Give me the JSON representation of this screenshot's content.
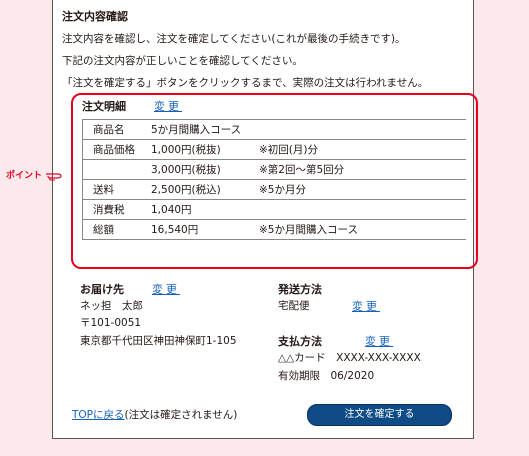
{
  "intro": {
    "title": "注文内容確認",
    "line1": "注文内容を確認し、注文を確定してください(これが最後の手続きです)。",
    "line2": "下記の注文内容が正しいことを確認してください。",
    "line3": "「注文を確定する」ボタンをクリックするまで、実際の注文は行われません。"
  },
  "point_label": "ポイント",
  "details": {
    "title": "注文明細",
    "change_link": "変更",
    "rows": [
      {
        "label": "商品名",
        "value": "5か月間購入コース",
        "note": ""
      },
      {
        "label": "商品価格",
        "value": "1,000円(税抜)",
        "note": "※初回(月)分"
      },
      {
        "label": "",
        "value": "3,000円(税抜)",
        "note": "※第2回〜第5回分"
      },
      {
        "label": "送料",
        "value": "2,500円(税込)",
        "note": "※5か月分"
      },
      {
        "label": "消費税",
        "value": "1,040円",
        "note": ""
      },
      {
        "label": "総額",
        "value": "16,540円",
        "note": "※5か月間購入コース"
      }
    ]
  },
  "delivery": {
    "title": "お届け先",
    "change_link": "変更",
    "name": "ネッ担　太郎",
    "postal": "〒101-0051",
    "address": "東京都千代田区神田神保町1-105"
  },
  "shipping": {
    "title": "発送方法",
    "method": "宅配便",
    "change_link": "変更"
  },
  "payment": {
    "title": "支払方法",
    "change_link": "変更",
    "card": "△△カード　XXXX-XXX-XXXX",
    "expiry": "有効期限　06/2020"
  },
  "footer": {
    "top_link": "TOPに戻る",
    "top_note": "(注文は確定されません)",
    "confirm_button": "注文を確定する"
  }
}
